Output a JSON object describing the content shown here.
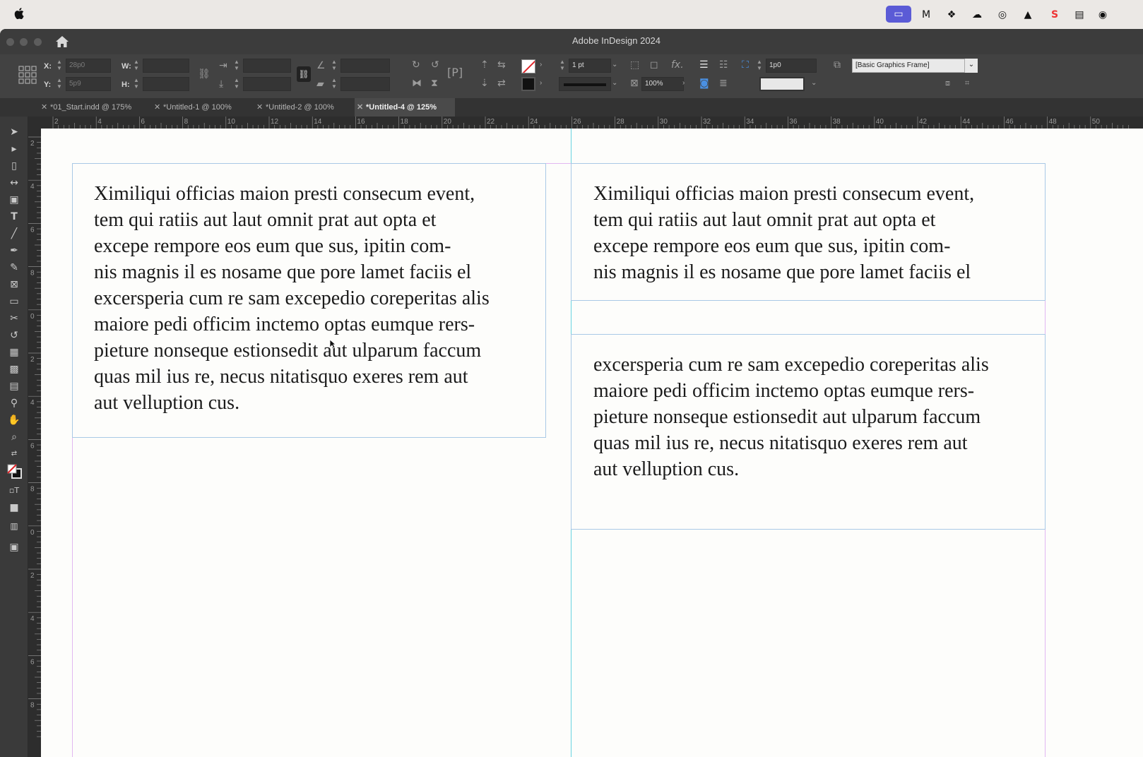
{
  "window": {
    "title": "Adobe InDesign 2024"
  },
  "control": {
    "x_label": "X:",
    "x_value": "28p0",
    "y_label": "Y:",
    "y_value": "5p9",
    "w_label": "W:",
    "h_label": "H:",
    "stroke_weight": "1 pt",
    "opacity": "100%",
    "offset": "1p0",
    "object_style": "[Basic Graphics Frame]",
    "fx_label": "fx."
  },
  "tabs": [
    {
      "label": "*01_Start.indd @ 175%"
    },
    {
      "label": "*Untitled-1 @ 100%"
    },
    {
      "label": "*Untitled-2 @ 100%"
    },
    {
      "label": "*Untitled-4 @ 125%"
    }
  ],
  "ruler": {
    "top_ticks": [
      "2",
      "4",
      "6",
      "8",
      "10",
      "12",
      "14",
      "16",
      "18",
      "20",
      "22",
      "24",
      "26",
      "28",
      "30",
      "32",
      "34",
      "36",
      "38",
      "40",
      "42",
      "44",
      "46",
      "48",
      "50"
    ],
    "left_ticks": [
      "2",
      "4",
      "6",
      "8",
      "0",
      "2",
      "4",
      "6",
      "8",
      "0",
      "2",
      "4",
      "6",
      "8"
    ]
  },
  "frames": {
    "left": [
      "Ximiliqui officias maion presti consecum event,",
      "tem qui ratiis aut laut omnit prat aut opta et",
      "excepe rempore eos eum que sus, ipitin com-",
      "nis magnis il es nosame que pore lamet faciis el",
      "excersperia cum re sam excepedio coreperitas alis",
      "maiore pedi officim inctemo optas eumque rers-",
      "pieture nonseque estionsedit aut ulparum faccum",
      "quas mil ius re, necus nitatisquo exeres rem aut",
      "aut velluption cus."
    ],
    "right_top": [
      "Ximiliqui officias maion presti consecum event,",
      "tem qui ratiis aut laut omnit prat aut opta et",
      "excepe rempore eos eum que sus, ipitin com-",
      "nis magnis il es nosame que pore lamet faciis el"
    ],
    "right_bottom": [
      "excersperia cum re sam excepedio coreperitas alis",
      "maiore pedi officim inctemo optas eumque rers-",
      "pieture nonseque estionsedit aut ulparum faccum",
      "quas mil ius re, necus nitatisquo exeres rem aut",
      "aut velluption cus."
    ]
  }
}
